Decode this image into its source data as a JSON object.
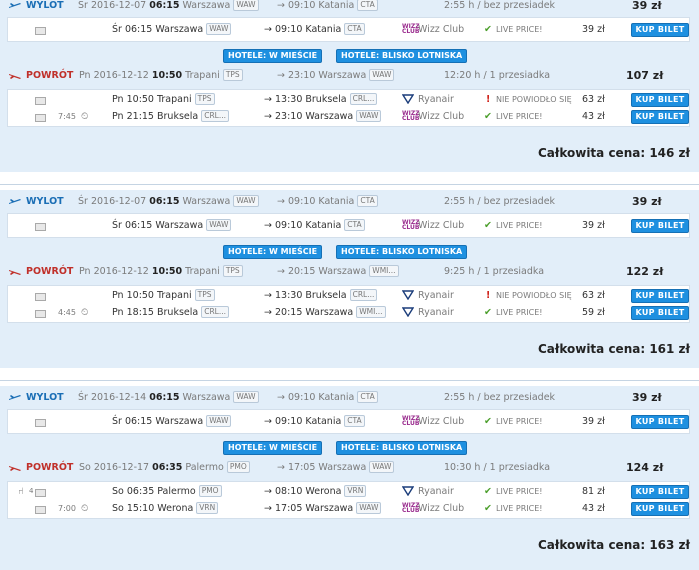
{
  "labels": {
    "outbound": "WYLOT",
    "return": "POWRÓT",
    "hotel_city": "HOTELE: W MIEŚCIE",
    "hotel_airport": "HOTELE: BLISKO LOTNISKA",
    "buy": "KUP BILET",
    "total_prefix": "Całkowita cena:"
  },
  "colors": {
    "accent_blue": "#1e90e0",
    "panel_bg": "#e2eef9",
    "outbound_blue": "#1a6eb5",
    "return_red": "#c0302a",
    "ok_green": "#4a9e2a",
    "warn_red": "#d0241c"
  },
  "results": [
    {
      "outbound": {
        "day": "Śr",
        "date": "2016-12-07",
        "time": "06:15",
        "from_city": "Warszawa",
        "from_code": "WAW",
        "arr_time": "09:10",
        "to_city": "Katania",
        "to_code": "CTA",
        "duration": "2:55 h / bez przesiadek",
        "price": "39 zł",
        "segments": [
          {
            "layover": "",
            "layover_icon": "",
            "dep": "Śr 06:15 Warszawa",
            "dep_code": "WAW",
            "arr": "09:10 Katania",
            "arr_code": "CTA",
            "carrier": "Wizz Club",
            "carrier_icon": "wizz-logo-icon",
            "status": "LIVE PRICE!",
            "status_ok": true,
            "price": "39 zł"
          }
        ]
      },
      "return": {
        "day": "Pn",
        "date": "2016-12-12",
        "time": "10:50",
        "from_city": "Trapani",
        "from_code": "TPS",
        "arr_time": "23:10",
        "to_city": "Warszawa",
        "to_code": "WAW",
        "duration": "12:20 h / 1 przesiadka",
        "price": "107 zł",
        "segments": [
          {
            "layover": "",
            "layover_icon": "",
            "dep": "Pn 10:50 Trapani",
            "dep_code": "TPS",
            "arr": "13:30 Bruksela",
            "arr_code": "CRL...",
            "carrier": "Ryanair",
            "carrier_icon": "ryanair-logo-icon",
            "status": "NIE POWIODŁO SIĘ",
            "status_ok": false,
            "price": "63 zł"
          },
          {
            "layover": "7:45",
            "layover_icon": "clock-icon",
            "dep": "Pn 21:15 Bruksela",
            "dep_code": "CRL...",
            "arr": "23:10 Warszawa",
            "arr_code": "WAW",
            "carrier": "Wizz Club",
            "carrier_icon": "wizz-logo-icon",
            "status": "LIVE PRICE!",
            "status_ok": true,
            "price": "43 zł"
          }
        ]
      },
      "total": "146 zł"
    },
    {
      "outbound": {
        "day": "Śr",
        "date": "2016-12-07",
        "time": "06:15",
        "from_city": "Warszawa",
        "from_code": "WAW",
        "arr_time": "09:10",
        "to_city": "Katania",
        "to_code": "CTA",
        "duration": "2:55 h / bez przesiadek",
        "price": "39 zł",
        "segments": [
          {
            "layover": "",
            "layover_icon": "",
            "dep": "Śr 06:15 Warszawa",
            "dep_code": "WAW",
            "arr": "09:10 Katania",
            "arr_code": "CTA",
            "carrier": "Wizz Club",
            "carrier_icon": "wizz-logo-icon",
            "status": "LIVE PRICE!",
            "status_ok": true,
            "price": "39 zł"
          }
        ]
      },
      "return": {
        "day": "Pn",
        "date": "2016-12-12",
        "time": "10:50",
        "from_city": "Trapani",
        "from_code": "TPS",
        "arr_time": "20:15",
        "to_city": "Warszawa",
        "to_code": "WMI...",
        "duration": "9:25 h / 1 przesiadka",
        "price": "122 zł",
        "segments": [
          {
            "layover": "",
            "layover_icon": "",
            "dep": "Pn 10:50 Trapani",
            "dep_code": "TPS",
            "arr": "13:30 Bruksela",
            "arr_code": "CRL...",
            "carrier": "Ryanair",
            "carrier_icon": "ryanair-logo-icon",
            "status": "NIE POWIODŁO SIĘ",
            "status_ok": false,
            "price": "63 zł"
          },
          {
            "layover": "4:45",
            "layover_icon": "clock-icon",
            "dep": "Pn 18:15 Bruksela",
            "dep_code": "CRL...",
            "arr": "20:15 Warszawa",
            "arr_code": "WMI...",
            "carrier": "Ryanair",
            "carrier_icon": "ryanair-logo-icon",
            "status": "LIVE PRICE!",
            "status_ok": true,
            "price": "59 zł"
          }
        ]
      },
      "total": "161 zł"
    },
    {
      "outbound": {
        "day": "Śr",
        "date": "2016-12-14",
        "time": "06:15",
        "from_city": "Warszawa",
        "from_code": "WAW",
        "arr_time": "09:10",
        "to_city": "Katania",
        "to_code": "CTA",
        "duration": "2:55 h / bez przesiadek",
        "price": "39 zł",
        "segments": [
          {
            "layover": "",
            "layover_icon": "",
            "dep": "Śr 06:15 Warszawa",
            "dep_code": "WAW",
            "arr": "09:10 Katania",
            "arr_code": "CTA",
            "carrier": "Wizz Club",
            "carrier_icon": "wizz-logo-icon",
            "status": "LIVE PRICE!",
            "status_ok": true,
            "price": "39 zł"
          }
        ]
      },
      "return": {
        "day": "So",
        "date": "2016-12-17",
        "time": "06:35",
        "from_city": "Palermo",
        "from_code": "PMO",
        "arr_time": "17:05",
        "to_city": "Warszawa",
        "to_code": "WAW",
        "duration": "10:30 h / 1 przesiadka",
        "price": "124 zł",
        "segments": [
          {
            "layover": "4",
            "layover_icon": "seat-icon",
            "dep": "So 06:35 Palermo",
            "dep_code": "PMO",
            "arr": "08:10 Werona",
            "arr_code": "VRN",
            "carrier": "Ryanair",
            "carrier_icon": "ryanair-logo-icon",
            "status": "LIVE PRICE!",
            "status_ok": true,
            "price": "81 zł"
          },
          {
            "layover": "7:00",
            "layover_icon": "clock-icon",
            "dep": "So 15:10 Werona",
            "dep_code": "VRN",
            "arr": "17:05 Warszawa",
            "arr_code": "WAW",
            "carrier": "Wizz Club",
            "carrier_icon": "wizz-logo-icon",
            "status": "LIVE PRICE!",
            "status_ok": true,
            "price": "43 zł"
          }
        ]
      },
      "total": "163 zł"
    }
  ]
}
